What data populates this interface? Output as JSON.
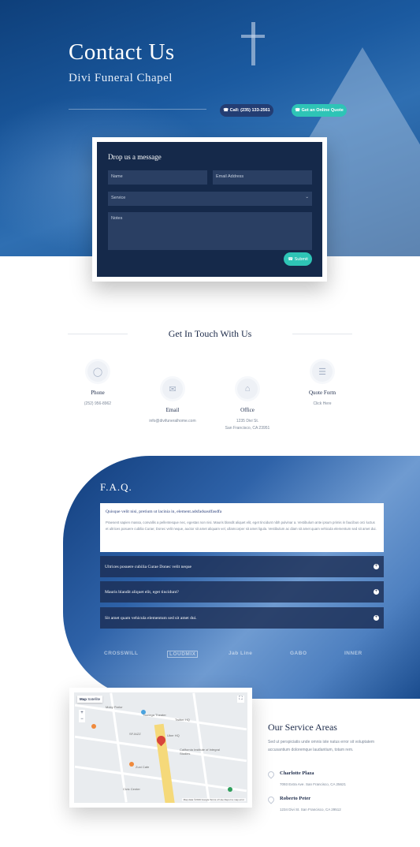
{
  "hero": {
    "title": "Contact Us",
    "subtitle": "Divi Funeral Chapel",
    "call_button": "☎ Call: (235) 133-2561",
    "quote_button": "☎ Get an Online Quote"
  },
  "form": {
    "title": "Drop us a message",
    "name_placeholder": "Name",
    "email_placeholder": "Email Address",
    "service_placeholder": "Service",
    "notes_placeholder": "Notes",
    "submit_label": "☎ Submit"
  },
  "touch": {
    "title": "Get In Touch With Us",
    "items": [
      {
        "icon": "chat-icon",
        "label": "Phone",
        "value": "(252) 956-8962"
      },
      {
        "icon": "mail-icon",
        "label": "Email",
        "value": "info@divifuneralhome.com"
      },
      {
        "icon": "home-icon",
        "label": "Office",
        "value": "1235 Divi St.",
        "value2": "San Francisco, CA 23951"
      },
      {
        "icon": "document-icon",
        "label": "Quote Form",
        "value": "Click Here"
      }
    ]
  },
  "faq": {
    "title": "F.A.Q.",
    "open_question": "Quisque velit nisi, pretium ut lacinia in, element.adsfadsasdfasdfa",
    "open_answer": "Praesent sapien massa, convallis a pellentesque nec, egestas non nisi. Mauris blandit aliquet elit, eget tincidunt nibh pulvinar a. Vestibulum ante ipsum primis in faucibus orci luctus et ultrices posuere cubilia Curae; Donec velit neque, auctor sit amet aliquam vel, ullamcorper sit amet ligula. Vestibulum ac diam sit amet quam vehicula elementum sed sit amet dui.",
    "items": [
      "Ultrices posuere cubilia Curae Donec velit neque",
      "Mauris blandit aliquet elit, eget tincidunt?",
      "Sit amet quam vehicula elementum sed sit amet dui."
    ],
    "logos": [
      "CROSSWILL",
      "LOUDMIX",
      "Jab Line",
      "GABO",
      "INNER"
    ]
  },
  "map": {
    "tab_map": "Map",
    "tab_satellite": "Satellite",
    "labels": [
      "Moby Parlor",
      "Noriega Theater",
      "Twitter HQ",
      "Uber HQ",
      "SFJAZZ",
      "California Institute of Integral Studies",
      "Zuni Cafe",
      "Civic Center"
    ],
    "footer": "Map data ©2019 Google  Terms of Use  Report a map error"
  },
  "service": {
    "title": "Our Service Areas",
    "description": "Sed ut perspiciatis unde omnis iste natus error sit voluptatem accusantium doloremque laudantium, totam rem.",
    "locations": [
      {
        "name": "Charlotte Plaza",
        "address": "7093 Extra Ave. San Francisco, CA 25621"
      },
      {
        "name": "Roberto Peter",
        "address": "1234 Divi St. San Francisco, CA 29512"
      }
    ]
  },
  "colors": {
    "navy": "#15294a",
    "teal": "#2ec4b6",
    "blue": "#1b5aa0"
  }
}
